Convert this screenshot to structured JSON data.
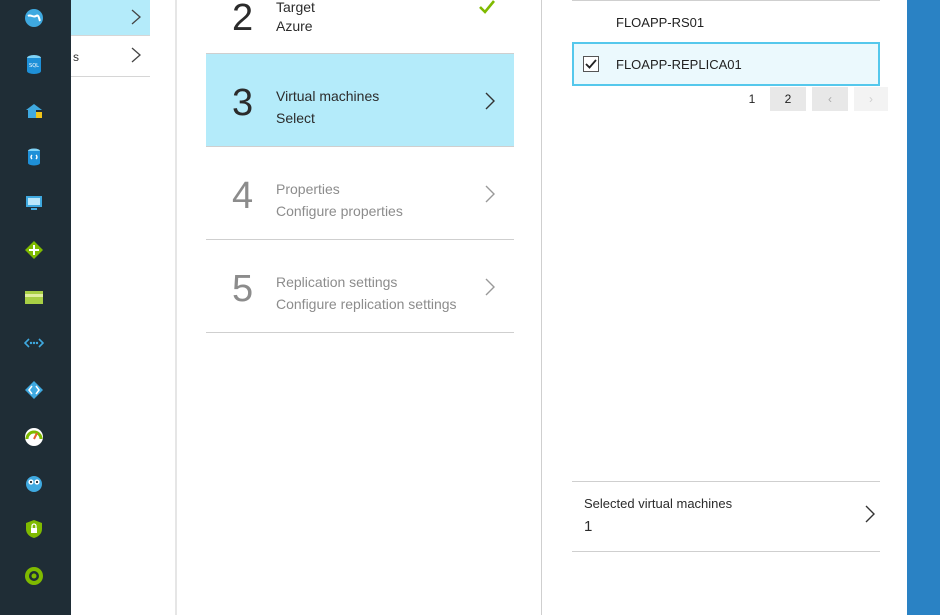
{
  "nav_rail": {
    "icons": [
      "globe-icon",
      "sql-database-icon",
      "building-icon",
      "storage-cylinder-icon",
      "monitor-icon",
      "network-diamond-icon",
      "card-icon",
      "connection-dots-icon",
      "code-diamond-icon",
      "gauge-icon",
      "owl-icon",
      "shield-lock-icon",
      "circle-power-icon"
    ],
    "sql_badge": "SQL"
  },
  "blade1": {
    "items": [
      {
        "label": "",
        "active": true
      },
      {
        "label": "s",
        "active": false
      }
    ]
  },
  "steps": [
    {
      "number": "2",
      "title": "Target",
      "subtitle": "Azure",
      "state": "done"
    },
    {
      "number": "3",
      "title": "Virtual machines",
      "subtitle": "Select",
      "state": "active"
    },
    {
      "number": "4",
      "title": "Properties",
      "subtitle": "Configure properties",
      "state": "pending"
    },
    {
      "number": "5",
      "title": "Replication settings",
      "subtitle": "Configure replication settings",
      "state": "pending"
    }
  ],
  "vm_list": {
    "rows": [
      {
        "name": "FLOAPP-RS01",
        "checked": false
      },
      {
        "name": "FLOAPP-REPLICA01",
        "checked": true
      }
    ],
    "pager": {
      "pages": [
        "1",
        "2"
      ],
      "current": "2",
      "prev": "‹",
      "next": "›"
    }
  },
  "selection": {
    "label": "Selected virtual machines",
    "count": "1"
  },
  "colors": {
    "rail": "#1f2d36",
    "active_step": "#b4ebfa",
    "selected_row_border": "#55c8ec",
    "check_green": "#7fba00",
    "right_strip": "#2a82c4"
  }
}
